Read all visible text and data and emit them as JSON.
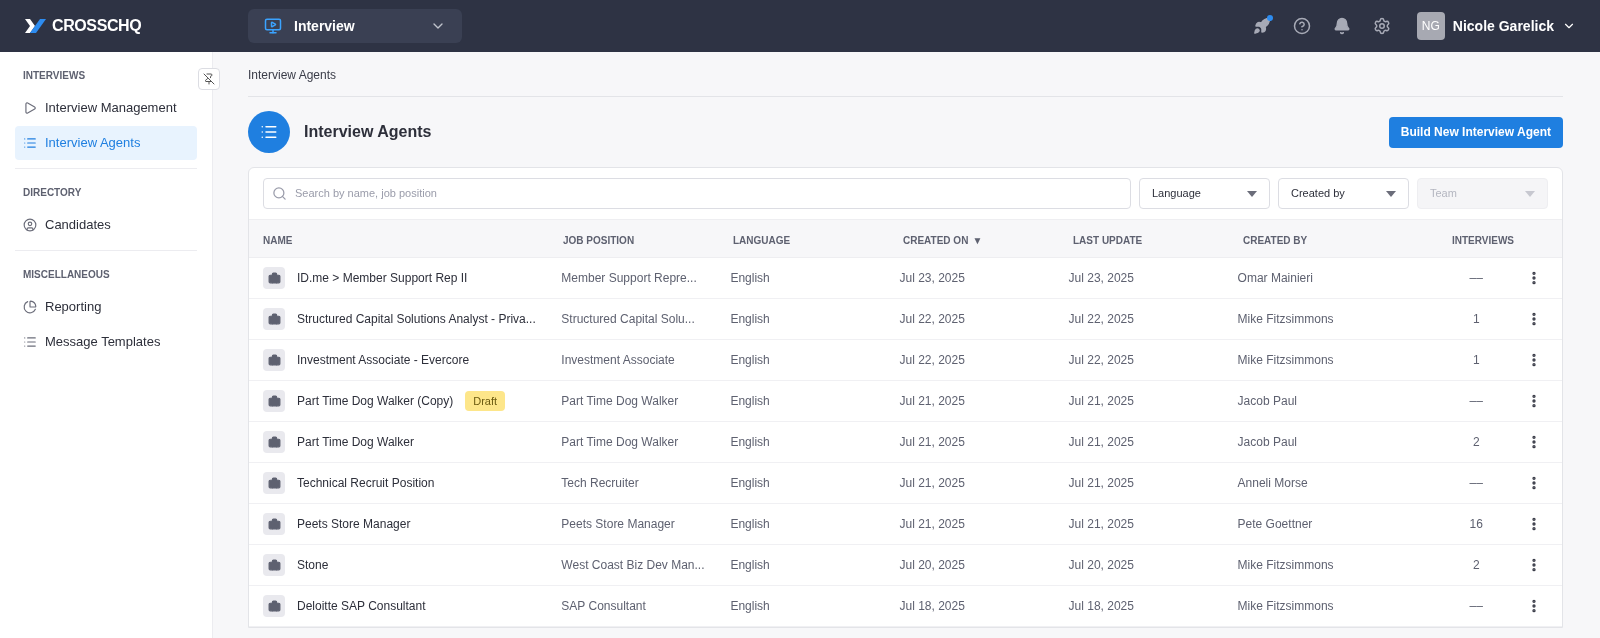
{
  "topbar": {
    "logo": "CROSSCHQ",
    "product_switcher": {
      "label": "Interview"
    },
    "notification_dot": true,
    "user": {
      "initials": "NG",
      "name": "Nicole Garelick"
    }
  },
  "sidebar": {
    "sections": [
      {
        "title": "INTERVIEWS",
        "items": [
          {
            "label": "Interview Management",
            "selected": false
          },
          {
            "label": "Interview Agents",
            "selected": true
          }
        ]
      },
      {
        "title": "DIRECTORY",
        "items": [
          {
            "label": "Candidates",
            "selected": false
          }
        ]
      },
      {
        "title": "MISCELLANEOUS",
        "items": [
          {
            "label": "Reporting",
            "selected": false
          },
          {
            "label": "Message Templates",
            "selected": false
          }
        ]
      }
    ]
  },
  "breadcrumb": "Interview Agents",
  "page_title": "Interview Agents",
  "primary_button": "Build New Interview Agent",
  "filters": {
    "search": {
      "placeholder": "Search by name, job position"
    },
    "dropdowns": [
      {
        "label": "Language",
        "disabled": false
      },
      {
        "label": "Created by",
        "disabled": false
      },
      {
        "label": "Team",
        "disabled": true
      }
    ]
  },
  "table": {
    "columns": [
      {
        "label": "NAME"
      },
      {
        "label": "JOB POSITION"
      },
      {
        "label": "LANGUAGE"
      },
      {
        "label": "CREATED ON",
        "sort": "▼"
      },
      {
        "label": "LAST UPDATE"
      },
      {
        "label": "CREATED BY"
      },
      {
        "label": "INTERVIEWS"
      }
    ],
    "rows": [
      {
        "name": "ID.me > Member Support Rep II",
        "job": "Member Support Repre...",
        "language": "English",
        "created": "Jul 23, 2025",
        "updated": "Jul 23, 2025",
        "created_by": "Omar Mainieri",
        "interviews": "––"
      },
      {
        "name": "Structured Capital Solutions Analyst - Priva...",
        "job": "Structured Capital Solu...",
        "language": "English",
        "created": "Jul 22, 2025",
        "updated": "Jul 22, 2025",
        "created_by": "Mike Fitzsimmons",
        "interviews": "1"
      },
      {
        "name": "Investment Associate - Evercore",
        "job": "Investment Associate",
        "language": "English",
        "created": "Jul 22, 2025",
        "updated": "Jul 22, 2025",
        "created_by": "Mike Fitzsimmons",
        "interviews": "1"
      },
      {
        "name": "Part Time Dog Walker (Copy)",
        "badge": "Draft",
        "job": "Part Time Dog Walker",
        "language": "English",
        "created": "Jul 21, 2025",
        "updated": "Jul 21, 2025",
        "created_by": "Jacob Paul",
        "interviews": "––"
      },
      {
        "name": "Part Time Dog Walker",
        "job": "Part Time Dog Walker",
        "language": "English",
        "created": "Jul 21, 2025",
        "updated": "Jul 21, 2025",
        "created_by": "Jacob Paul",
        "interviews": "2"
      },
      {
        "name": "Technical Recruit Position",
        "job": "Tech Recruiter",
        "language": "English",
        "created": "Jul 21, 2025",
        "updated": "Jul 21, 2025",
        "created_by": "Anneli Morse",
        "interviews": "––"
      },
      {
        "name": "Peets Store Manager",
        "job": "Peets Store Manager",
        "language": "English",
        "created": "Jul 21, 2025",
        "updated": "Jul 21, 2025",
        "created_by": "Pete Goettner",
        "interviews": "16"
      },
      {
        "name": "Stone",
        "job": "West Coast Biz Dev Man...",
        "language": "English",
        "created": "Jul 20, 2025",
        "updated": "Jul 20, 2025",
        "created_by": "Mike Fitzsimmons",
        "interviews": "2"
      },
      {
        "name": "Deloitte SAP Consultant",
        "job": "SAP Consultant",
        "language": "English",
        "created": "Jul 18, 2025",
        "updated": "Jul 18, 2025",
        "created_by": "Mike Fitzsimmons",
        "interviews": "––"
      }
    ]
  }
}
